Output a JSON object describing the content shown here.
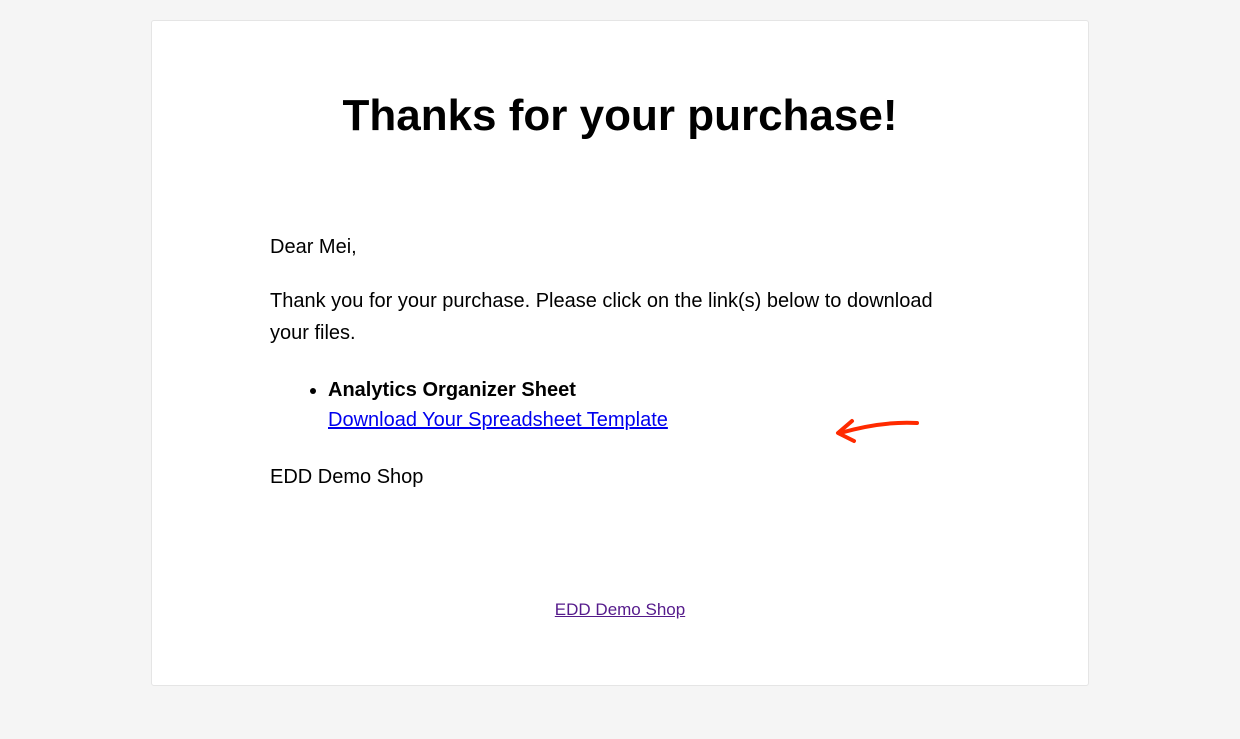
{
  "heading": "Thanks for your purchase!",
  "greeting": "Dear Mei,",
  "intro": "Thank you for your purchase. Please click on the link(s) below to download your files.",
  "product": {
    "name": "Analytics Organizer Sheet",
    "download_label": "Download Your Spreadsheet Template"
  },
  "signoff": "EDD Demo Shop",
  "footer_link_label": "EDD Demo Shop"
}
